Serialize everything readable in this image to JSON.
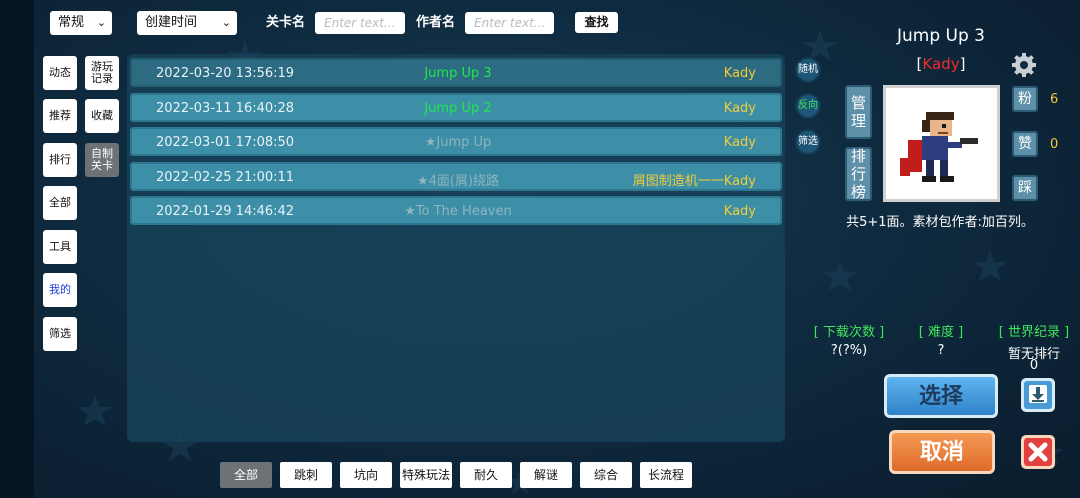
{
  "topbar": {
    "mode_select": "常规",
    "sort_select": "创建时间",
    "level_label": "关卡名",
    "level_placeholder": "Enter text...",
    "author_label": "作者名",
    "author_placeholder": "Enter text...",
    "search_button": "查找"
  },
  "nav_left": [
    "动态",
    "推荐",
    "排行",
    "全部",
    "工具",
    "我的",
    "筛选"
  ],
  "nav_right": [
    {
      "label": "游玩\n记录",
      "active": false
    },
    {
      "label": "收藏",
      "active": false
    },
    {
      "label": "自制\n关卡",
      "active": true
    }
  ],
  "levels": [
    {
      "date": "2022-03-20 13:56:19",
      "name": "Jump Up 3",
      "name_color": "green",
      "author": "Kady"
    },
    {
      "date": "2022-03-11 16:40:28",
      "name": "Jump Up 2",
      "name_color": "green",
      "author": "Kady"
    },
    {
      "date": "2022-03-01 17:08:50",
      "name": "★Jump Up",
      "name_color": "gray",
      "author": "Kady"
    },
    {
      "date": "2022-02-25 21:00:11",
      "name": "★4面(屑)绕路",
      "name_color": "gray",
      "author": "屑图制造机一一Kady"
    },
    {
      "date": "2022-01-29 14:46:42",
      "name": "★To The Heaven",
      "name_color": "gray",
      "author": "Kady"
    }
  ],
  "side_buttons": {
    "random": "随机",
    "reverse": "反向",
    "filter": "筛选"
  },
  "detail": {
    "title": "Jump Up 3",
    "author_open": "[",
    "author": "Kady",
    "author_close": "]",
    "manage_button": "管理",
    "rank_button": "排行榜",
    "fans_button": "粉",
    "fans_count": "6",
    "like_button": "赞",
    "like_count": "0",
    "dislike_button": "踩",
    "description": "共5+1面。素材包作者:加百列。",
    "downloads_header": "[ 下载次数 ]",
    "downloads_value": "?(?%)",
    "difficulty_header": "[ 难度 ]",
    "difficulty_value": "?",
    "record_header": "[ 世界纪录 ]",
    "record_value": "暂无排行",
    "record_value2": "0",
    "select_button": "选择",
    "cancel_button": "取消"
  },
  "filters": [
    "全部",
    "跳刺",
    "坑向",
    "特殊玩法",
    "耐久",
    "解谜",
    "综合",
    "长流程"
  ],
  "colors": {
    "accent_green": "#22e64a",
    "author_yellow": "#f2cc39",
    "author_red": "#f12b2b"
  }
}
